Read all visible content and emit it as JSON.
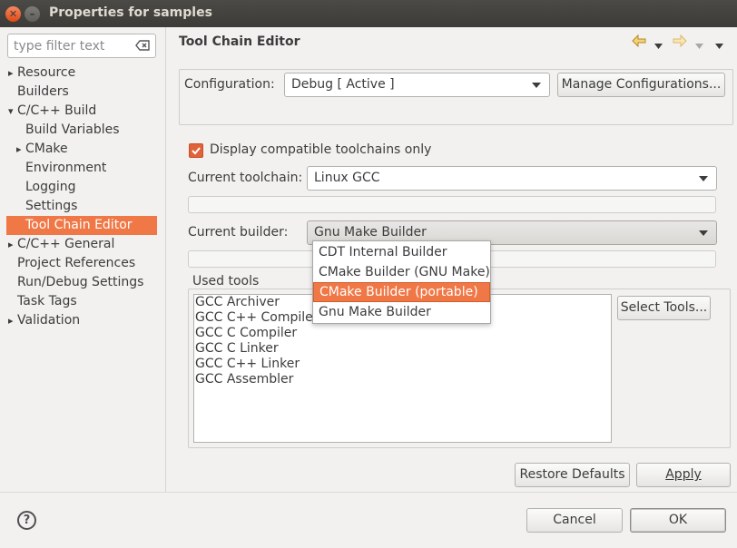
{
  "window": {
    "title": "Properties for samples"
  },
  "filter": {
    "placeholder": "type filter text"
  },
  "tree": [
    {
      "label": "Resource",
      "expandable": true,
      "indent": 0
    },
    {
      "label": "Builders",
      "expandable": false,
      "indent": 0
    },
    {
      "label": "C/C++ Build",
      "expandable": true,
      "expanded": true,
      "indent": 0
    },
    {
      "label": "Build Variables",
      "expandable": false,
      "indent": 1
    },
    {
      "label": "CMake",
      "expandable": true,
      "indent": 1
    },
    {
      "label": "Environment",
      "expandable": false,
      "indent": 1
    },
    {
      "label": "Logging",
      "expandable": false,
      "indent": 1
    },
    {
      "label": "Settings",
      "expandable": false,
      "indent": 1
    },
    {
      "label": "Tool Chain Editor",
      "expandable": false,
      "indent": 1,
      "selected": true
    },
    {
      "label": "C/C++ General",
      "expandable": true,
      "indent": 0
    },
    {
      "label": "Project References",
      "expandable": false,
      "indent": 0
    },
    {
      "label": "Run/Debug Settings",
      "expandable": false,
      "indent": 0
    },
    {
      "label": "Task Tags",
      "expandable": false,
      "indent": 0
    },
    {
      "label": "Validation",
      "expandable": true,
      "indent": 0
    }
  ],
  "page": {
    "title": "Tool Chain Editor",
    "configuration_label": "Configuration:",
    "configuration_value": "Debug  [ Active ]",
    "manage_button": "Manage Configurations...",
    "compatible_checkbox_label": "Display compatible toolchains only",
    "compatible_checked": true,
    "toolchain_label": "Current toolchain:",
    "toolchain_value": "Linux GCC",
    "builder_label": "Current builder:",
    "builder_value": "Gnu Make Builder",
    "builder_options": [
      "CDT Internal Builder",
      "CMake Builder (GNU Make)",
      "CMake Builder (portable)",
      "Gnu Make Builder"
    ],
    "builder_highlighted_index": 2,
    "used_tools_label": "Used tools",
    "used_tools": [
      "GCC Archiver",
      "GCC C++ Compiler",
      "GCC C Compiler",
      "GCC C Linker",
      "GCC C++ Linker",
      "GCC Assembler"
    ],
    "select_tools_button": "Select Tools...",
    "restore_defaults_button": "Restore Defaults",
    "apply_button": "Apply"
  },
  "footer": {
    "cancel_button": "Cancel",
    "ok_button": "OK"
  },
  "colors": {
    "accent": "#f07746",
    "titlebar": "#3c3b37",
    "background": "#f2f1f0"
  },
  "icons": {
    "close": "close-icon",
    "minimize": "minimize-icon",
    "clear": "clear-filter-icon",
    "back": "back-arrow-icon",
    "forward": "forward-arrow-icon",
    "help": "help-icon"
  }
}
